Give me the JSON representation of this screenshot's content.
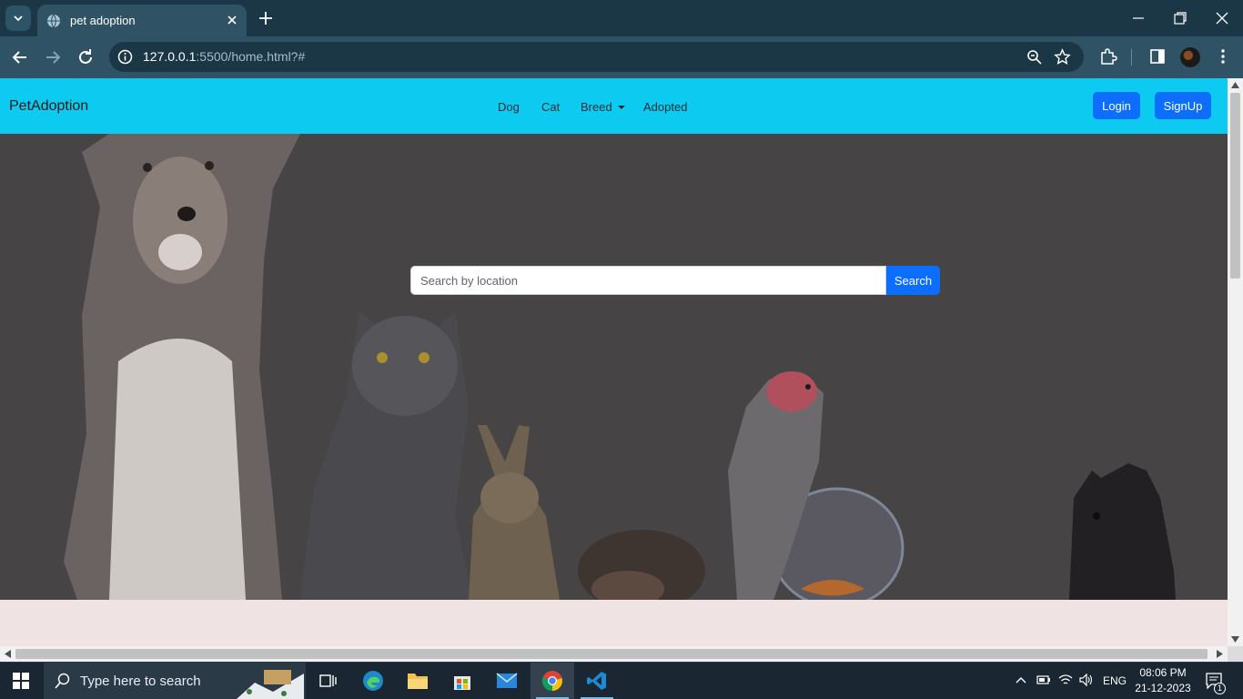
{
  "browser": {
    "tab_title": "pet adoption",
    "url_host": "127.0.0.1",
    "url_rest": ":5500/home.html?#"
  },
  "page": {
    "brand": "PetAdoption",
    "nav": [
      {
        "label": "Dog"
      },
      {
        "label": "Cat"
      },
      {
        "label": "Breed"
      },
      {
        "label": "Adopted"
      }
    ],
    "login_label": "Login",
    "signup_label": "SignUp",
    "search": {
      "placeholder": "Search by location",
      "button_label": "Search"
    },
    "colors": {
      "navbar": "#0dcaf0",
      "button": "#0d6efd",
      "hero_overlay": "#474445"
    }
  },
  "taskbar": {
    "search_placeholder": "Type here to search",
    "language": "ENG",
    "time": "08:06 PM",
    "date": "21-12-2023",
    "notification_count": "1"
  }
}
